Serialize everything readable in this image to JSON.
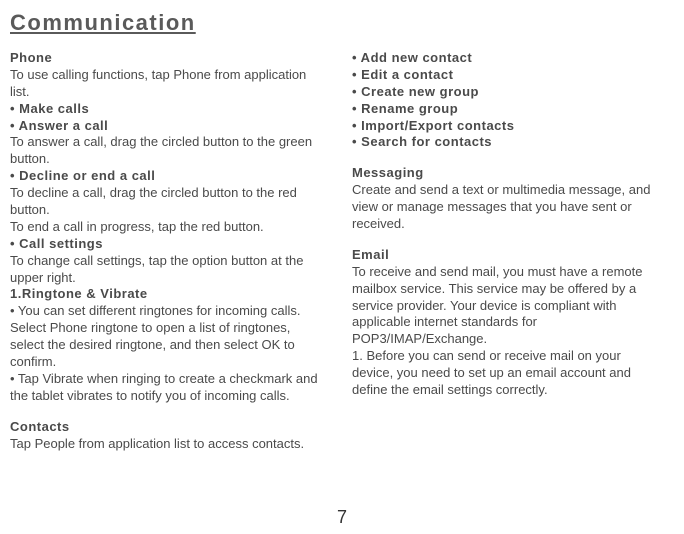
{
  "title": "Communication",
  "page_number": "7",
  "left": {
    "phone_heading": "Phone",
    "phone_intro": "To use calling functions, tap Phone from application list.",
    "make_calls": "• Make calls",
    "answer_call": "• Answer a call",
    "answer_text": "To answer a call, drag the circled button to the green button.",
    "decline_heading": "• Decline or end a call",
    "decline_text": "To decline a call, drag the circled button to the red button.",
    "end_text": "To end a call in progress, tap the red button.",
    "call_settings": "• Call settings",
    "call_settings_text": "To change call settings, tap the option button at the upper right.",
    "ringtone_heading": "1.Ringtone & Vibrate",
    "ringtone_text1": "• You can set different ringtones for incoming calls. Select Phone ringtone to open a list of ringtones, select the desired ringtone, and then select OK to confirm.",
    "ringtone_text2": "• Tap Vibrate when ringing to create a checkmark and the tablet vibrates to notify you of incoming calls.",
    "contacts_heading": "Contacts",
    "contacts_text": "Tap People from application list to access contacts."
  },
  "right": {
    "b1": "• Add new contact",
    "b2": "• Edit a contact",
    "b3": "• Create new group",
    "b4": "• Rename group",
    "b5": "• Import/Export contacts",
    "b6": "• Search for contacts",
    "messaging_heading": "Messaging",
    "messaging_text": "Create and send a text or multimedia message, and view or manage messages that you have sent or received.",
    "email_heading": "Email",
    "email_text1": "To receive and send mail, you must have a remote mailbox service. This service may be offered by a service provider. Your device is compliant with applicable internet standards for POP3/IMAP/Exchange.",
    "email_text2": "1. Before you can send or receive mail on your device, you need to set up an email account and define the email settings correctly."
  }
}
